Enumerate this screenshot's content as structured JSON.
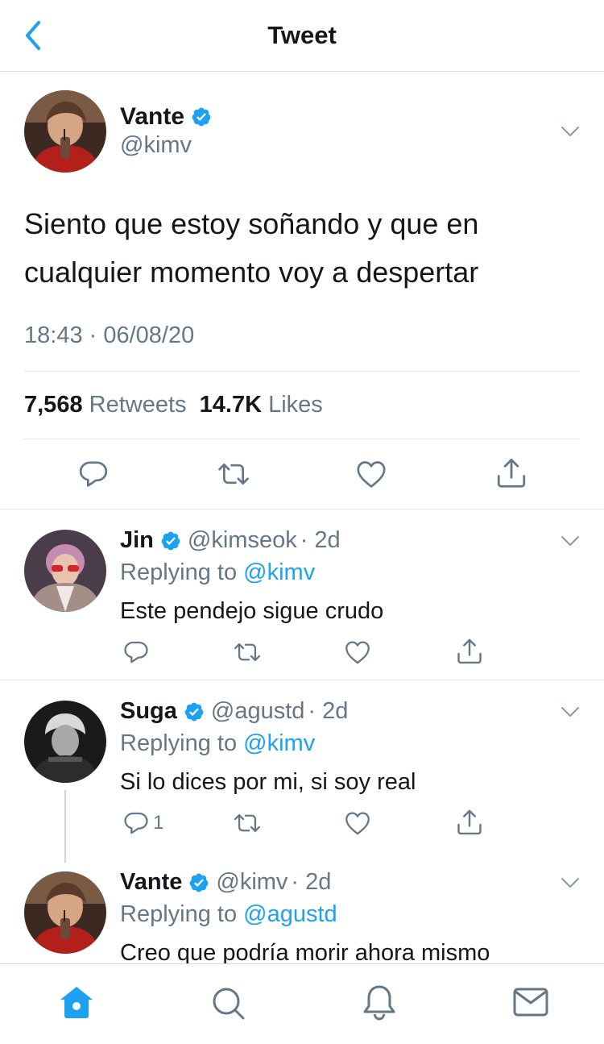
{
  "header": {
    "title": "Tweet"
  },
  "tweet": {
    "name": "Vante",
    "handle": "@kimv",
    "text": "Siento que estoy soñando y que en cualquier momento voy a despertar",
    "timestamp": "18:43 · 06/08/20",
    "retweets_count": "7,568",
    "retweets_label": "Retweets",
    "likes_count": "14.7K",
    "likes_label": "Likes"
  },
  "replies": [
    {
      "name": "Jin",
      "handle": "@kimseok",
      "time": "· 2d",
      "replying_prefix": "Replying to",
      "replying_to": "@kimv",
      "text": "Este pendejo sigue crudo",
      "reply_count": ""
    },
    {
      "name": "Suga",
      "handle": "@agustd",
      "time": "· 2d",
      "replying_prefix": "Replying to",
      "replying_to": "@kimv",
      "text": "Si lo dices por mi, si soy real",
      "reply_count": "1"
    },
    {
      "name": "Vante",
      "handle": "@kimv",
      "time": "· 2d",
      "replying_prefix": "Replying to",
      "replying_to": "@agustd",
      "text": "Creo que podría morir ahora mismo",
      "reply_count": ""
    }
  ],
  "tabbar": {
    "active": "home",
    "items": [
      "home-icon",
      "search-icon",
      "notifications-icon",
      "messages-icon"
    ]
  },
  "colors": {
    "accent": "#1da1f2",
    "muted": "#657786",
    "text": "#14171a",
    "divider": "#e1e8ed"
  }
}
